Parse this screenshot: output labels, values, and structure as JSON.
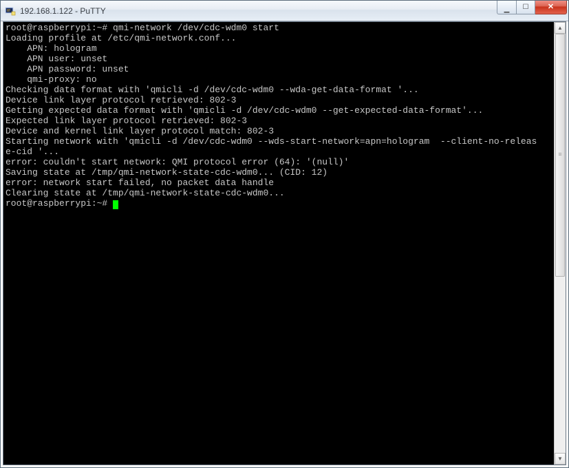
{
  "window": {
    "title": "192.168.1.122 - PuTTY"
  },
  "terminal": {
    "prompt1": "root@raspberrypi:~# ",
    "command1": "qmi-network /dev/cdc-wdm0 start",
    "lines": [
      "Loading profile at /etc/qmi-network.conf...",
      "    APN: hologram",
      "    APN user: unset",
      "    APN password: unset",
      "    qmi-proxy: no",
      "Checking data format with 'qmicli -d /dev/cdc-wdm0 --wda-get-data-format '...",
      "Device link layer protocol retrieved: 802-3",
      "Getting expected data format with 'qmicli -d /dev/cdc-wdm0 --get-expected-data-format'...",
      "Expected link layer protocol retrieved: 802-3",
      "Device and kernel link layer protocol match: 802-3",
      "Starting network with 'qmicli -d /dev/cdc-wdm0 --wds-start-network=apn=hologram  --client-no-releas",
      "e-cid '...",
      "error: couldn't start network: QMI protocol error (64): '(null)'",
      "Saving state at /tmp/qmi-network-state-cdc-wdm0... (CID: 12)",
      "error: network start failed, no packet data handle",
      "Clearing state at /tmp/qmi-network-state-cdc-wdm0..."
    ],
    "prompt2": "root@raspberrypi:~# "
  }
}
